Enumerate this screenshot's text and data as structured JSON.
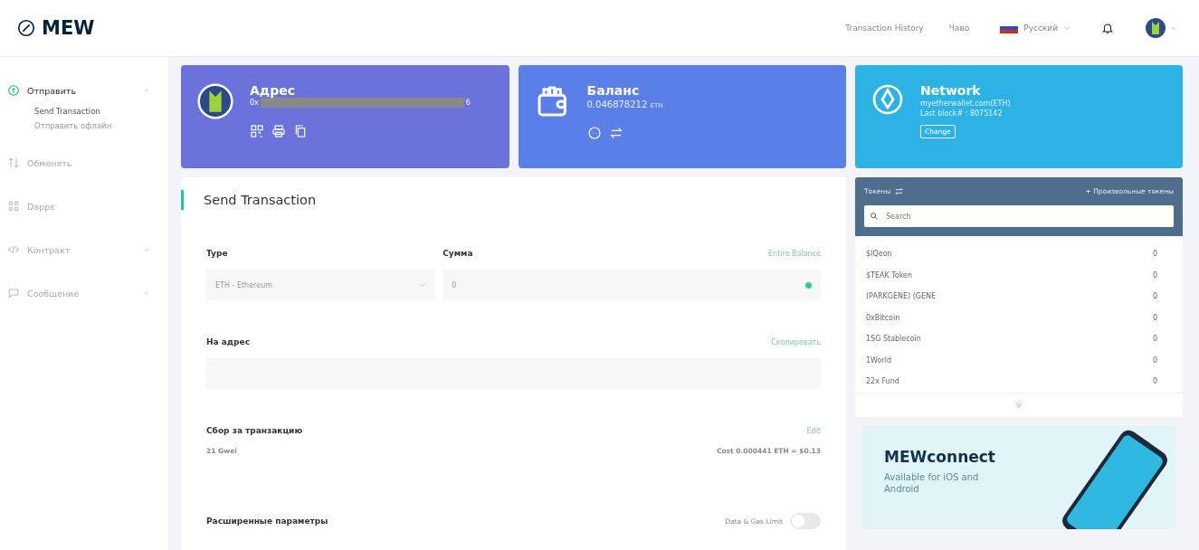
{
  "header": {
    "logo": "MEW",
    "links": [
      "Transaction History",
      "Чаво"
    ],
    "language": "Русский"
  },
  "sidebar": {
    "items": [
      {
        "label": "Отправить",
        "expandable": true,
        "expanded": true,
        "selected": true,
        "children": [
          {
            "label": "Send Transaction",
            "selected": true
          },
          {
            "label": "Отправить офлайн",
            "selected": false
          }
        ]
      },
      {
        "label": "Обменять",
        "expandable": false,
        "expanded": false,
        "selected": false
      },
      {
        "label": "Dapps",
        "expandable": false,
        "expanded": false,
        "selected": false
      },
      {
        "label": "Контракт",
        "expandable": true,
        "expanded": false,
        "selected": false
      },
      {
        "label": "Сообщение",
        "expandable": true,
        "expanded": false,
        "selected": false
      }
    ]
  },
  "address_card": {
    "title": "Адрес",
    "address_prefix": "0x",
    "address_suffix": "6"
  },
  "balance_card": {
    "title": "Баланс",
    "amount": "0.046878212",
    "unit": "ETH"
  },
  "network_card": {
    "title": "Network",
    "node": "myetherwallet.com(ETH)",
    "last_block": "Last block# : 8075142",
    "button": "Change"
  },
  "send_form": {
    "title": "Send Transaction",
    "type_label": "Type",
    "type_value": "ETH - Ethereum",
    "amount_label": "Сумма",
    "entire_balance": "Entire Balance",
    "amount_value": "0",
    "amount_valid": true,
    "to_label": "На адрес",
    "copy": "Скопировать",
    "fee_label": "Сбор за транзакцию",
    "fee_edit": "Edit",
    "gas_price": "21 Gwei",
    "cost": "Cost 0.000441 ETH = $0.13",
    "advanced_label": "Расширенные параметры",
    "data_gas_label": "Data & Gas Limit",
    "data_gas_on": false
  },
  "tokens": {
    "title": "Токены",
    "custom": "+ Произвольные токены",
    "search_placeholder": "Search",
    "rows": [
      {
        "name": "$IQeon",
        "balance": "0"
      },
      {
        "name": "$TEAK Token",
        "balance": "0"
      },
      {
        "name": "(PARKGENE) (GENE",
        "balance": "0"
      },
      {
        "name": "0xBitcoin",
        "balance": "0"
      },
      {
        "name": "1SG Stablecoin",
        "balance": "0"
      },
      {
        "name": "1World",
        "balance": "0"
      },
      {
        "name": "22x Fund",
        "balance": "0"
      }
    ]
  },
  "promo": {
    "title": "MEWconnect",
    "text": "Available for iOS and Android"
  }
}
